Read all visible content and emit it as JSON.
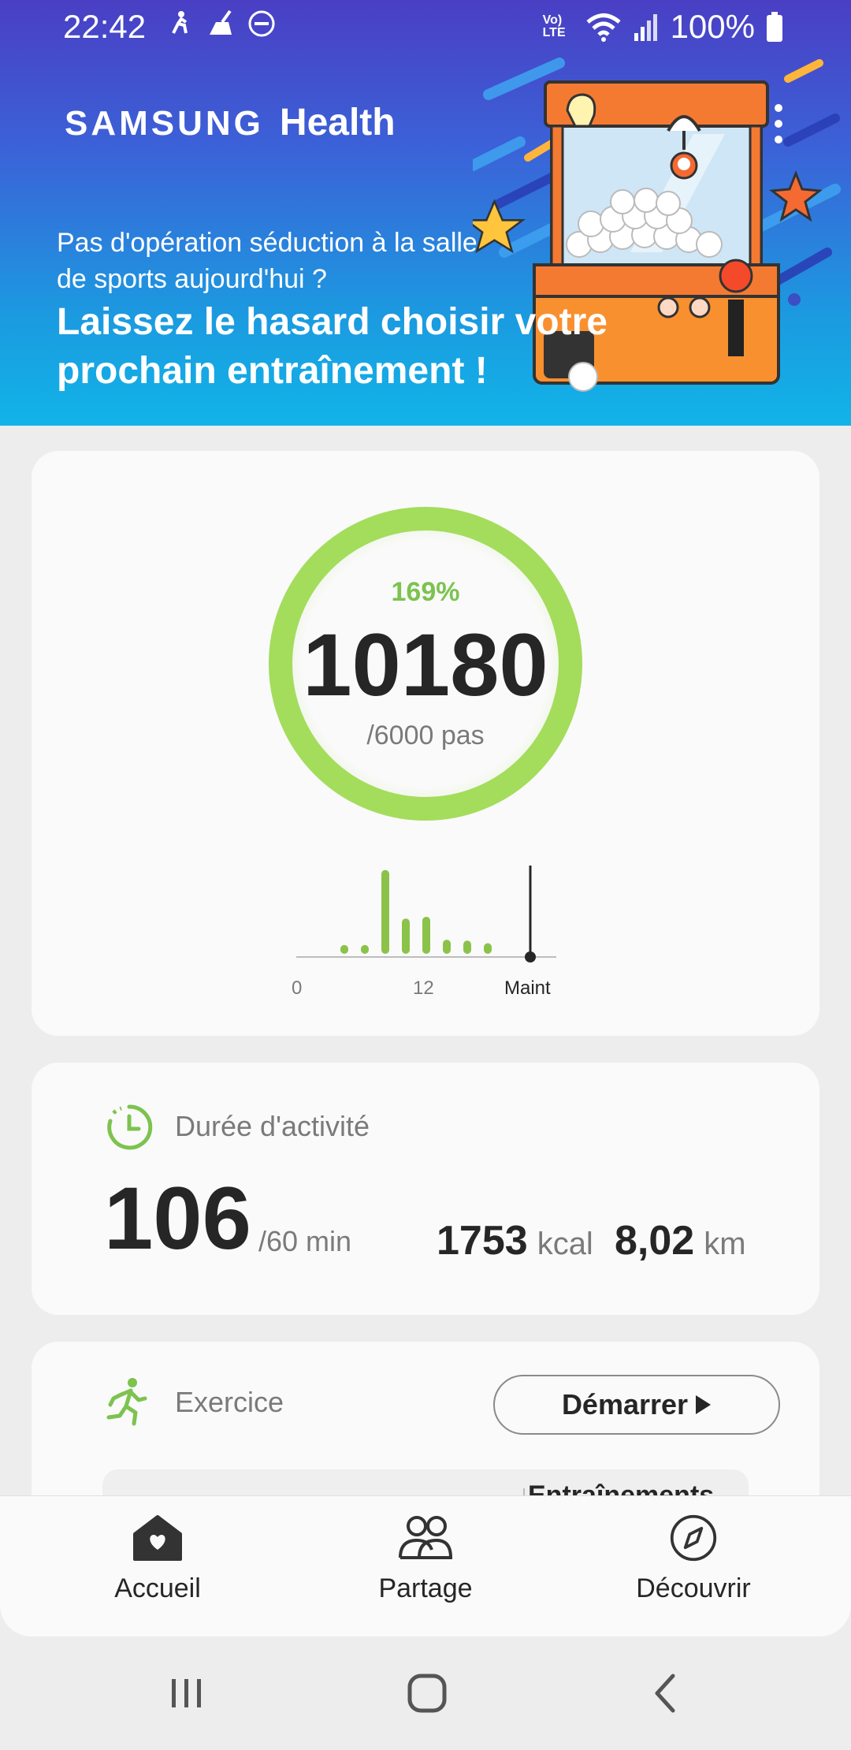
{
  "status_bar": {
    "time": "22:42",
    "network": "Vo) LTE",
    "battery": "100%"
  },
  "banner": {
    "brand_samsung": "SAMSUNG",
    "brand_health": "Health",
    "promo_subtitle": "Pas d'opération séduction à la salle de sports aujourd'hui ?",
    "promo_title": "Laissez le hasard choisir votre prochain entraînement !",
    "colors": {
      "top": "#4a3fc4",
      "bottom": "#11b4e8"
    }
  },
  "steps": {
    "percent": "169%",
    "value": "10180",
    "goal": "/6000 pas",
    "progress_fraction": 1.0,
    "ring_color": "#a3dd5b",
    "hourly_bars": [
      0.1,
      0.1,
      0.95,
      0.4,
      0.42,
      0.16,
      0.15,
      0.12
    ],
    "axis_labels": [
      "0",
      "12",
      "Maint"
    ]
  },
  "activity": {
    "title": "Durée d'activité",
    "value": "106",
    "goal": "/60 min",
    "kcal_value": "1753",
    "kcal_unit": "kcal",
    "distance_value": "8,02",
    "distance_unit": "km"
  },
  "exercise": {
    "title": "Exercice",
    "start_label": "Démarrer",
    "sub_label": "Entraînements"
  },
  "bottom_nav": {
    "items": [
      {
        "label": "Accueil",
        "icon": "home-heart-icon"
      },
      {
        "label": "Partage",
        "icon": "people-icon"
      },
      {
        "label": "Découvrir",
        "icon": "compass-icon"
      }
    ]
  },
  "system_nav": {
    "icons": [
      "recent-apps-icon",
      "home-icon",
      "back-icon"
    ]
  }
}
